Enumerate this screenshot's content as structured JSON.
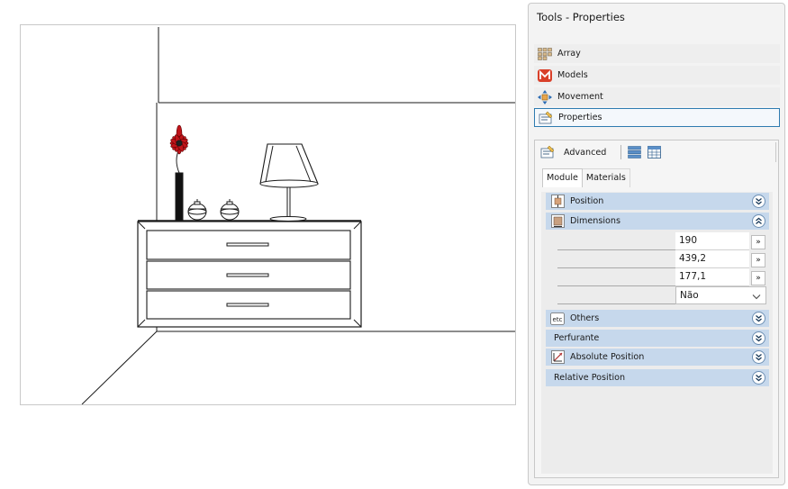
{
  "panel": {
    "title": "Tools - Properties",
    "tools": [
      {
        "label": "Array",
        "icon": "array-icon"
      },
      {
        "label": "Models",
        "icon": "models-icon"
      },
      {
        "label": "Movement",
        "icon": "movement-icon"
      },
      {
        "label": "Properties",
        "icon": "properties-icon"
      }
    ],
    "advanced_label": "Advanced",
    "tabs": [
      "Module",
      "Materials"
    ],
    "sections": {
      "position": "Position",
      "dimensions": "Dimensions",
      "others": "Others",
      "perfurante": "Perfurante",
      "absolute_position": "Absolute Position",
      "relative_position": "Relative Position"
    },
    "dimension_values": [
      "190",
      "439,2",
      "177,1"
    ],
    "more_button_label": "»",
    "select_value": "Não"
  },
  "colors": {
    "accent": "#2e7bb0",
    "section_bg": "#c6d8ec",
    "flower_red": "#c0141a"
  }
}
